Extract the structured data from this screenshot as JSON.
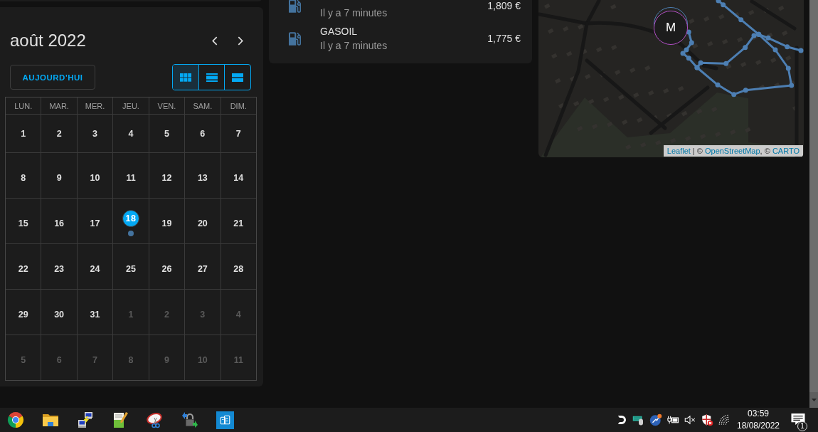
{
  "calendar": {
    "title": "août 2022",
    "today_button": "AUJOURD'HUI",
    "views": [
      {
        "kind": "month",
        "selected": true
      },
      {
        "kind": "week",
        "selected": false
      },
      {
        "kind": "day",
        "selected": false
      }
    ],
    "weekdays": [
      "LUN.",
      "MAR.",
      "MER.",
      "JEU.",
      "VEN.",
      "SAM.",
      "DIM."
    ],
    "days": [
      {
        "day": "1",
        "other_month": false,
        "today": false
      },
      {
        "day": "2",
        "other_month": false,
        "today": false
      },
      {
        "day": "3",
        "other_month": false,
        "today": false
      },
      {
        "day": "4",
        "other_month": false,
        "today": false
      },
      {
        "day": "5",
        "other_month": false,
        "today": false
      },
      {
        "day": "6",
        "other_month": false,
        "today": false
      },
      {
        "day": "7",
        "other_month": false,
        "today": false
      },
      {
        "day": "8",
        "other_month": false,
        "today": false
      },
      {
        "day": "9",
        "other_month": false,
        "today": false
      },
      {
        "day": "10",
        "other_month": false,
        "today": false
      },
      {
        "day": "11",
        "other_month": false,
        "today": false
      },
      {
        "day": "12",
        "other_month": false,
        "today": false
      },
      {
        "day": "13",
        "other_month": false,
        "today": false
      },
      {
        "day": "14",
        "other_month": false,
        "today": false
      },
      {
        "day": "15",
        "other_month": false,
        "today": false
      },
      {
        "day": "16",
        "other_month": false,
        "today": false
      },
      {
        "day": "17",
        "other_month": false,
        "today": false
      },
      {
        "day": "18",
        "other_month": false,
        "today": true,
        "events": [
          {
            "color": "#44739e"
          }
        ]
      },
      {
        "day": "19",
        "other_month": false,
        "today": false
      },
      {
        "day": "20",
        "other_month": false,
        "today": false
      },
      {
        "day": "21",
        "other_month": false,
        "today": false
      },
      {
        "day": "22",
        "other_month": false,
        "today": false
      },
      {
        "day": "23",
        "other_month": false,
        "today": false
      },
      {
        "day": "24",
        "other_month": false,
        "today": false
      },
      {
        "day": "25",
        "other_month": false,
        "today": false
      },
      {
        "day": "26",
        "other_month": false,
        "today": false
      },
      {
        "day": "27",
        "other_month": false,
        "today": false
      },
      {
        "day": "28",
        "other_month": false,
        "today": false
      },
      {
        "day": "29",
        "other_month": false,
        "today": false
      },
      {
        "day": "30",
        "other_month": false,
        "today": false
      },
      {
        "day": "31",
        "other_month": false,
        "today": false
      },
      {
        "day": "1",
        "other_month": true,
        "today": false
      },
      {
        "day": "2",
        "other_month": true,
        "today": false
      },
      {
        "day": "3",
        "other_month": true,
        "today": false
      },
      {
        "day": "4",
        "other_month": true,
        "today": false
      },
      {
        "day": "5",
        "other_month": true,
        "today": false
      },
      {
        "day": "6",
        "other_month": true,
        "today": false
      },
      {
        "day": "7",
        "other_month": true,
        "today": false
      },
      {
        "day": "8",
        "other_month": true,
        "today": false
      },
      {
        "day": "9",
        "other_month": true,
        "today": false
      },
      {
        "day": "10",
        "other_month": true,
        "today": false
      },
      {
        "day": "11",
        "other_month": true,
        "today": false
      }
    ]
  },
  "fuel_card": {
    "rows": [
      {
        "secondary": "Il y a 7 minutes",
        "value": "1,809 €"
      },
      {
        "title": "GASOIL",
        "secondary": "Il y a 7 minutes",
        "value": "1,775 €"
      }
    ]
  },
  "map": {
    "marker": "M",
    "attribution": [
      {
        "kind": "link",
        "text": "Leaflet"
      },
      {
        "kind": "text",
        "text": " | © "
      },
      {
        "kind": "link",
        "text": "OpenStreetMap"
      },
      {
        "kind": "text",
        "text": ", © "
      },
      {
        "kind": "link",
        "text": "CARTO"
      }
    ]
  },
  "taskbar": {
    "clock": {
      "time": "03:59",
      "date": "18/08/2022"
    },
    "notification_count": "1"
  }
}
